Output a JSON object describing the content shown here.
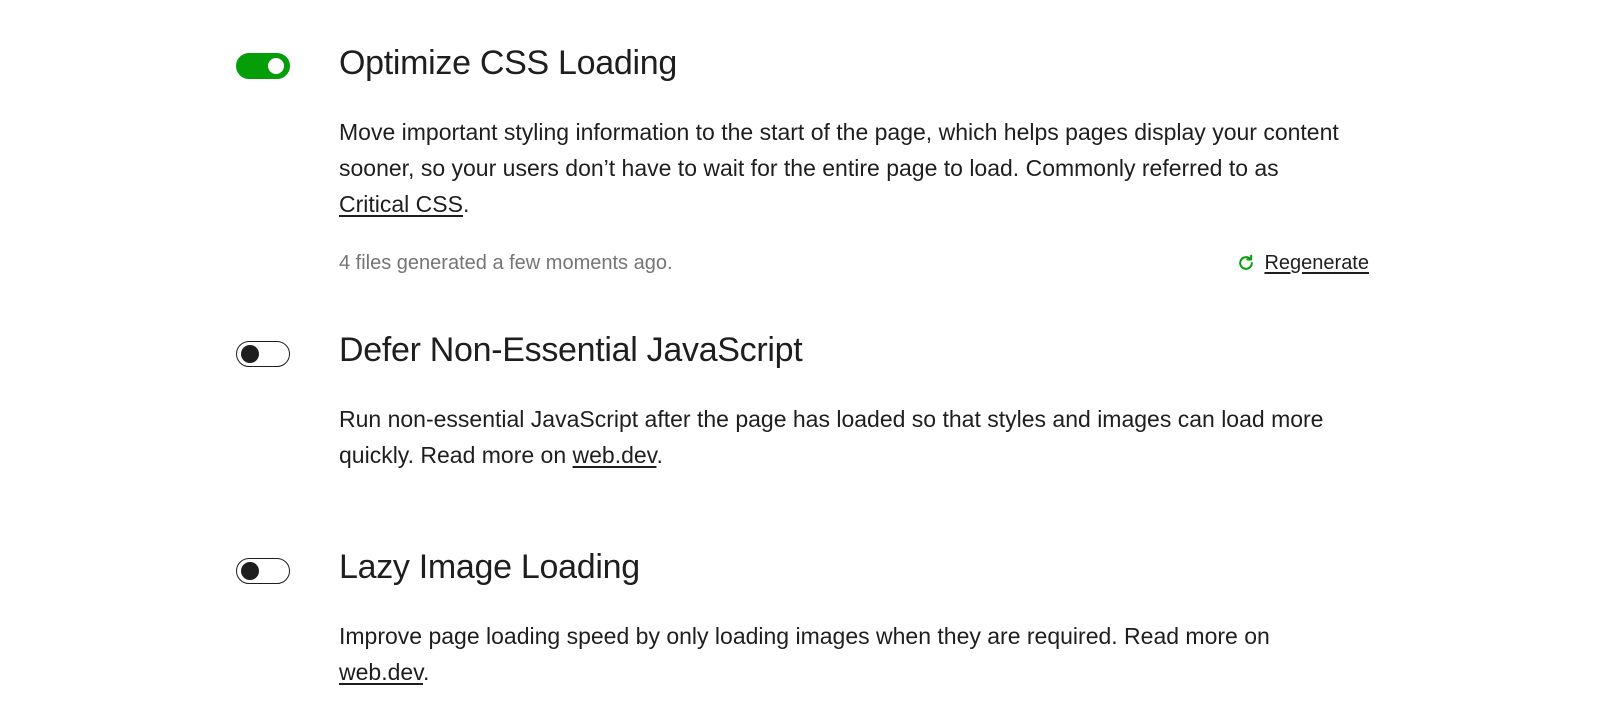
{
  "modules": [
    {
      "title": "Optimize CSS Loading",
      "enabled": true,
      "description": "Move important styling information to the start of the page, which helps pages display your content sooner, so your users don’t have to wait for the entire page to load. Commonly referred to as ",
      "link_text": "Critical CSS",
      "after_link": ".",
      "status": "4 files generated a few moments ago.",
      "action_label": "Regenerate",
      "action_icon": "refresh-icon"
    },
    {
      "title": "Defer Non-Essential JavaScript",
      "enabled": false,
      "description": "Run non-essential JavaScript after the page has loaded so that styles and images can load more quickly. Read more on ",
      "link_text": "web.dev",
      "after_link": "."
    },
    {
      "title": "Lazy Image Loading",
      "enabled": false,
      "description": "Improve page loading speed by only loading images when they are required. Read more on ",
      "link_text": "web.dev",
      "after_link": "."
    }
  ],
  "colors": {
    "toggle_on": "#069e08",
    "toggle_off_border": "#1e1e1e",
    "text": "#1e1e1e",
    "muted_text": "#757575",
    "regenerate_icon": "#069e08"
  }
}
